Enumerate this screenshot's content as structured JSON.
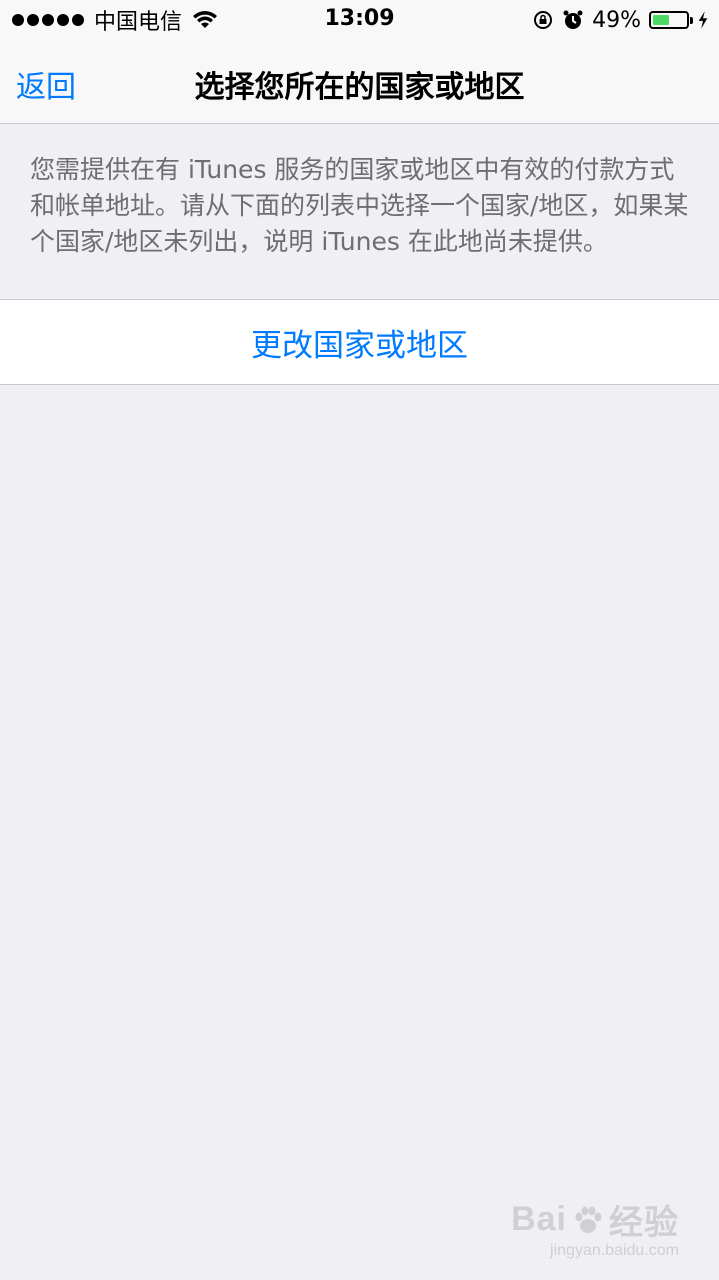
{
  "status_bar": {
    "carrier": "中国电信",
    "time": "13:09",
    "battery_percent": "49%",
    "battery_level": 0.49,
    "battery_color": "#4cd964",
    "icons": [
      "signal-dots",
      "wifi-icon",
      "rotation-lock-icon",
      "alarm-icon",
      "battery-icon",
      "charging-bolt-icon"
    ]
  },
  "nav": {
    "back_label": "返回",
    "title": "选择您所在的国家或地区"
  },
  "description": "您需提供在有 iTunes 服务的国家或地区中有效的付款方式和帐单地址。请从下面的列表中选择一个国家/地区，如果某个国家/地区未列出，说明 iTunes 在此地尚未提供。",
  "actions": {
    "change_region_label": "更改国家或地区"
  },
  "colors": {
    "accent": "#007aff",
    "background": "#efeff4",
    "secondary_text": "#6d6d72"
  },
  "watermark": {
    "logo": "Bai du 经验",
    "url": "jingyan.baidu.com"
  }
}
